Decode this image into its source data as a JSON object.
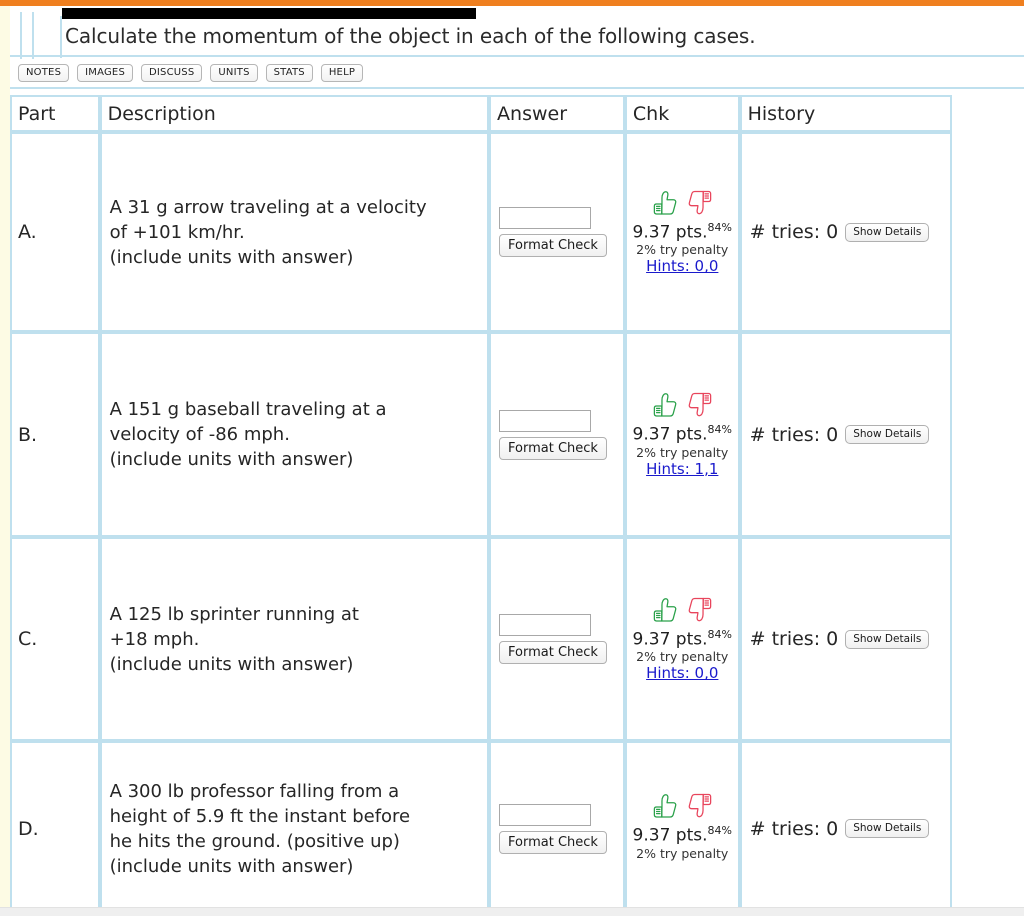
{
  "theme": {
    "accent_orange": "#ef7f1f",
    "border_blue": "#bfe0ee",
    "link_blue": "#1a1acc",
    "thumb_up_green": "#2aa14a",
    "thumb_down_red": "#e8455c",
    "gutter_cream": "#fdfbe4"
  },
  "prompt": {
    "text": "Calculate the momentum of the object in each of the following cases."
  },
  "toolbar": {
    "buttons": [
      {
        "label": "NOTES",
        "name": "notes-button"
      },
      {
        "label": "IMAGES",
        "name": "images-button"
      },
      {
        "label": "DISCUSS",
        "name": "discuss-button"
      },
      {
        "label": "UNITS",
        "name": "units-button"
      },
      {
        "label": "STATS",
        "name": "stats-button"
      },
      {
        "label": "HELP",
        "name": "help-button"
      }
    ]
  },
  "table": {
    "headers": {
      "part": "Part",
      "description": "Description",
      "answer": "Answer",
      "chk": "Chk",
      "history": "History"
    },
    "rows": [
      {
        "part": "A.",
        "description_lines": [
          "A 31 g arrow traveling at a velocity",
          "of +101 km/hr.",
          "(include units with answer)"
        ],
        "answer_value": "",
        "answer_placeholder": "",
        "format_check_label": "Format Check",
        "points": "9.37 pts.",
        "percent": "84%",
        "penalty": "2% try penalty",
        "hints": "Hints: 0,0",
        "tries": "# tries: 0",
        "details_label": "Show Details"
      },
      {
        "part": "B.",
        "description_lines": [
          "A 151 g baseball traveling at a",
          "velocity of -86 mph.",
          "(include units with answer)"
        ],
        "answer_value": "",
        "answer_placeholder": "",
        "format_check_label": "Format Check",
        "points": "9.37 pts.",
        "percent": "84%",
        "penalty": "2% try penalty",
        "hints": "Hints: 1,1",
        "tries": "# tries: 0",
        "details_label": "Show Details"
      },
      {
        "part": "C.",
        "description_lines": [
          "A 125 lb sprinter running at",
          "+18 mph.",
          "(include units with answer)"
        ],
        "answer_value": "",
        "answer_placeholder": "",
        "format_check_label": "Format Check",
        "points": "9.37 pts.",
        "percent": "84%",
        "penalty": "2% try penalty",
        "hints": "Hints: 0,0",
        "tries": "# tries: 0",
        "details_label": "Show Details"
      },
      {
        "part": "D.",
        "description_lines": [
          "A 300 lb professor falling from a",
          "height of 5.9 ft the instant before",
          "he hits the ground. (positive up)",
          "(include units with answer)"
        ],
        "answer_value": "",
        "answer_placeholder": "",
        "format_check_label": "Format Check",
        "points": "9.37 pts.",
        "percent": "84%",
        "penalty": "2% try penalty",
        "hints": "",
        "tries": "# tries: 0",
        "details_label": "Show Details"
      }
    ]
  },
  "icons": {
    "thumb_up": "thumbs-up-icon",
    "thumb_down": "thumbs-down-icon"
  }
}
